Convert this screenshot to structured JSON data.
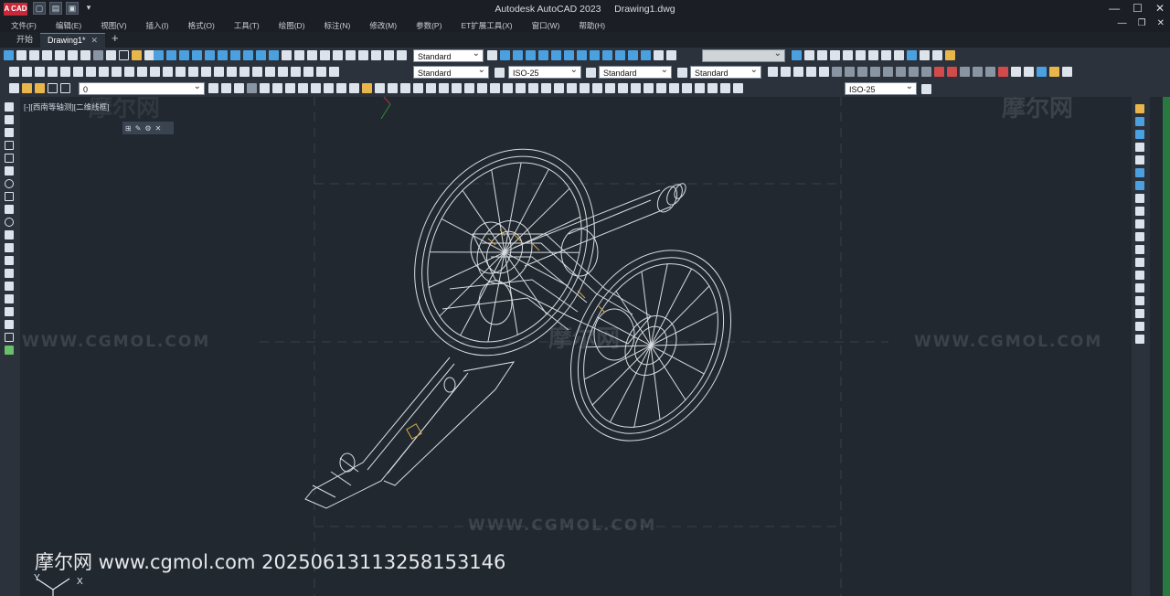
{
  "titlebar": {
    "app_logo": "A CAD",
    "app_title": "Autodesk AutoCAD 2023",
    "doc_title": "Drawing1.dwg"
  },
  "menu": {
    "items": [
      "文件(F)",
      "编辑(E)",
      "视图(V)",
      "插入(I)",
      "格式(O)",
      "工具(T)",
      "绘图(D)",
      "标注(N)",
      "修改(M)",
      "参数(P)",
      "ET扩展工具(X)",
      "窗口(W)",
      "帮助(H)"
    ]
  },
  "tabs": {
    "start": "开始",
    "document": "Drawing1*",
    "close": "✕",
    "add": "+"
  },
  "toolbars": {
    "text_style_1": "Standard",
    "text_style_2": "Standard",
    "dim_style": "ISO-25",
    "table_style": "Standard",
    "multileader_style": "Standard",
    "layer": "0",
    "dim_style_2": "ISO-25"
  },
  "viewport": {
    "label": "[-][西南等轴测][二维线框]",
    "watermark_cg": "WWW.CGMOL.COM",
    "watermark_cn": "摩尔网",
    "watermark_footer": "摩尔网 www.cgmol.com 20250613113258153146",
    "ucs_x": "X",
    "ucs_y": "Y"
  },
  "colors": {
    "background": "#212830",
    "toolbar": "#2b323b",
    "wireframe": "#e8ecf0",
    "accent": "#e8b64a",
    "logo": "#c8283a"
  }
}
